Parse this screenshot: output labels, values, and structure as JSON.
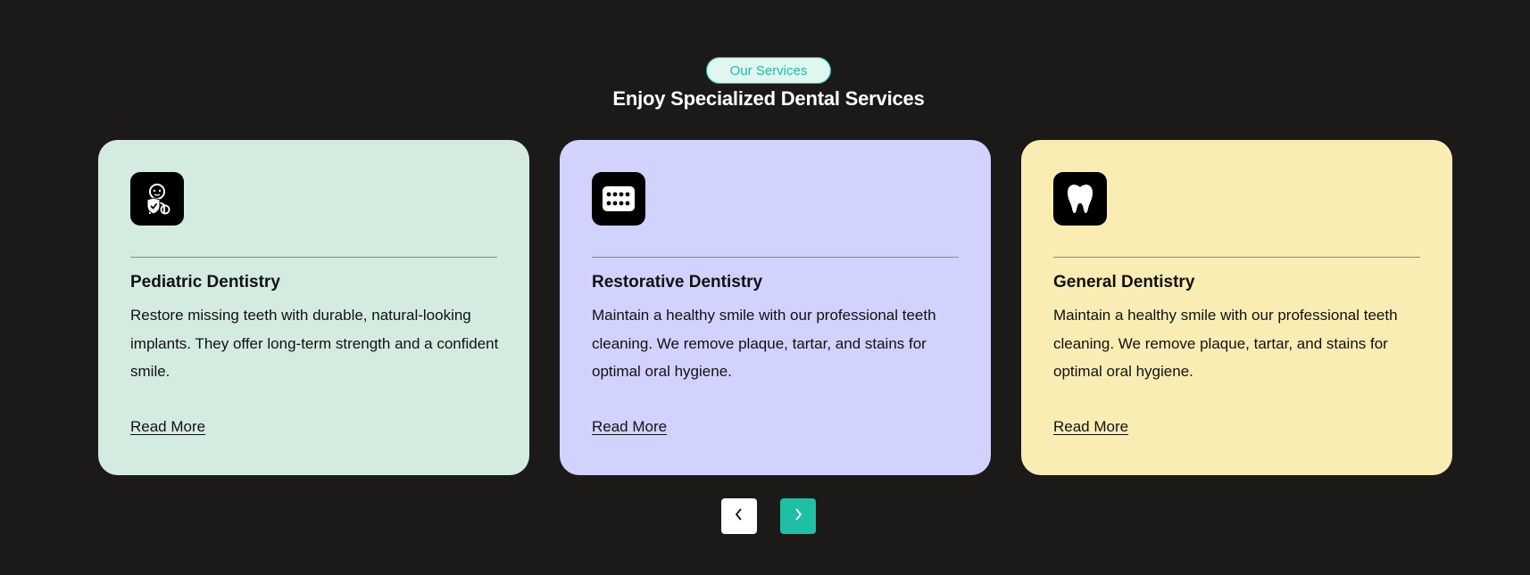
{
  "section": {
    "badge": "Our Services",
    "heading": "Enjoy Specialized Dental Services"
  },
  "cards": [
    {
      "icon": "baby-shield-icon",
      "bg": "#d4ecdf",
      "title": "Pediatric Dentistry",
      "description": "Restore missing teeth with durable, natural-looking implants. They offer long-term strength and a confident smile.",
      "link": "Read More"
    },
    {
      "icon": "teeth-grid-icon",
      "bg": "#d2d2fe",
      "title": "Restorative Dentistry",
      "description": "Maintain a healthy smile with our professional teeth cleaning. We remove plaque, tartar, and stains for optimal oral hygiene.",
      "link": "Read More"
    },
    {
      "icon": "tooth-icon",
      "bg": "#faedb4",
      "title": "General Dentistry",
      "description": "Maintain a healthy smile with our professional teeth cleaning. We remove plaque, tartar, and stains for optimal oral hygiene.",
      "link": "Read More"
    }
  ],
  "navigation": {
    "prev_icon": "chevron-left-icon",
    "next_icon": "chevron-right-icon",
    "prev_bg": "#ffffff",
    "next_bg": "#1fbfa5"
  },
  "colors": {
    "background": "#1b1a19",
    "accent": "#1fbfa5"
  }
}
